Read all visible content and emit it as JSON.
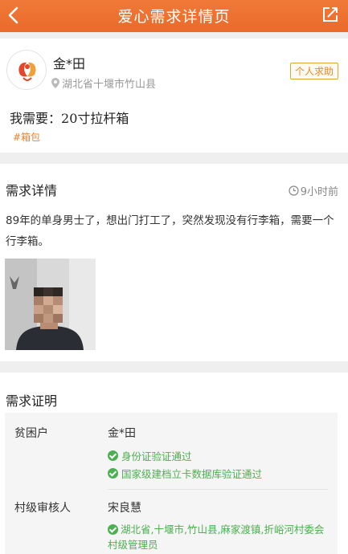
{
  "header": {
    "title": "爱心需求详情页"
  },
  "requester": {
    "name": "金*田",
    "location": "湖北省十堰市竹山县",
    "badge": "个人求助",
    "need_label": "我需要：",
    "need_value": "20寸拉杆箱",
    "tag": "#箱包"
  },
  "detail": {
    "title": "需求详情",
    "time": "9小时前",
    "description": "89年的单身男士了，想出门打工了，突然发现没有行李箱，需要一个行李箱。"
  },
  "proof": {
    "title": "需求证明",
    "rows": [
      {
        "label": "贫困户",
        "value": "金*田",
        "checks": [
          "身份证验证通过",
          "国家级建档立卡数据库验证通过"
        ]
      },
      {
        "label": "村级审核人",
        "value": "宋良慧",
        "checks": [
          "湖北省,十堰市,竹山县,麻家渡镇,折峪河村委会 村级管理员"
        ]
      }
    ]
  },
  "colors": {
    "header": "#ec6f30",
    "accent": "#e9832f",
    "verified": "#4caf50"
  }
}
